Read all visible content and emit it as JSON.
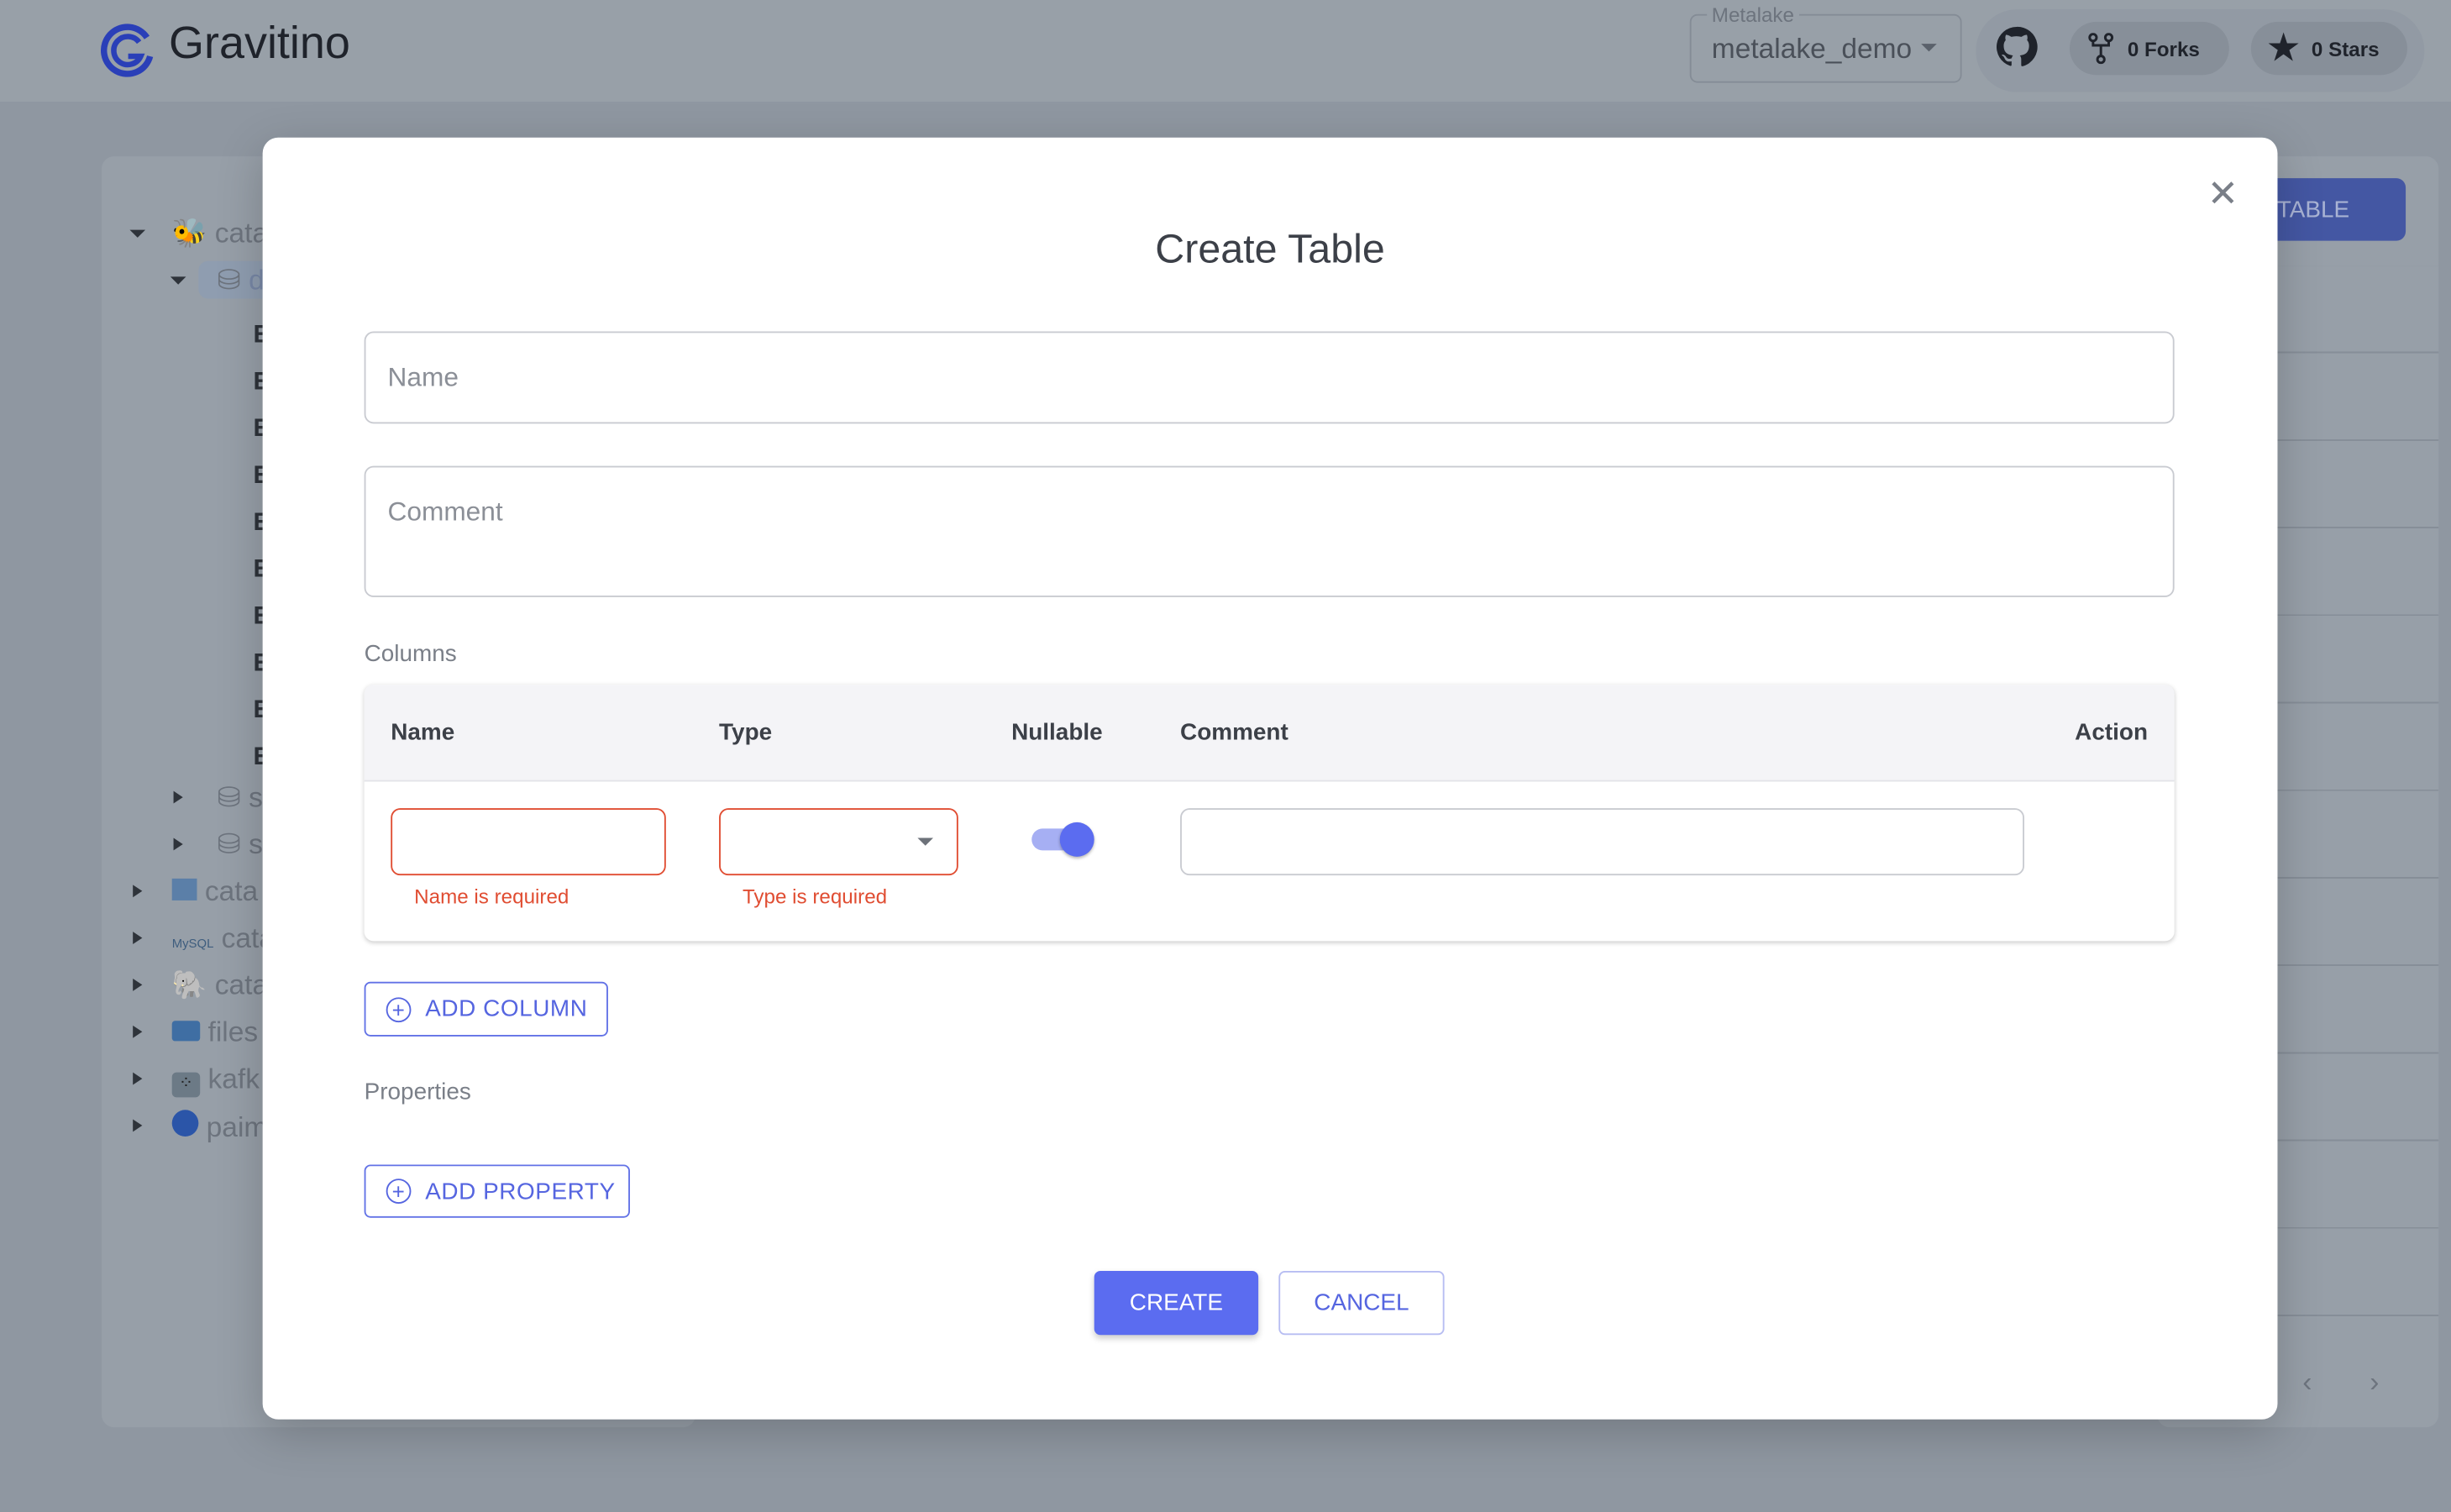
{
  "app": {
    "name": "Gravitino"
  },
  "header": {
    "metalake_label": "Metalake",
    "metalake_value": "metalake_demo",
    "forks": "0 Forks",
    "stars": "0 Stars"
  },
  "sidebar": {
    "items": [
      {
        "label": "cata",
        "icon": "hive-icon",
        "expanded": true
      },
      {
        "label": "d",
        "icon": "database-icon",
        "expanded": true
      },
      {
        "label": "s",
        "icon": "database-icon"
      },
      {
        "label": "s",
        "icon": "database-icon"
      },
      {
        "label": "cata",
        "icon": "iceberg-icon"
      },
      {
        "label": "cata",
        "icon": "mysql-icon"
      },
      {
        "label": "cata",
        "icon": "postgresql-icon"
      },
      {
        "label": "files",
        "icon": "folder-icon"
      },
      {
        "label": "kafk",
        "icon": "kafka-icon"
      },
      {
        "label": "paim",
        "icon": "paimon-icon"
      }
    ]
  },
  "background": {
    "create_table_button": "TABLE"
  },
  "modal": {
    "title": "Create Table",
    "name_placeholder": "Name",
    "comment_placeholder": "Comment",
    "columns_label": "Columns",
    "columns_headers": {
      "name": "Name",
      "type": "Type",
      "nullable": "Nullable",
      "comment": "Comment",
      "action": "Action"
    },
    "row": {
      "name": "",
      "type": "",
      "nullable": true,
      "comment": "",
      "name_error": "Name is required",
      "type_error": "Type is required"
    },
    "add_column": "ADD COLUMN",
    "properties_label": "Properties",
    "add_property": "ADD PROPERTY",
    "create": "CREATE",
    "cancel": "CANCEL"
  },
  "colors": {
    "primary": "#5b6cf0",
    "error": "#e04d32"
  }
}
